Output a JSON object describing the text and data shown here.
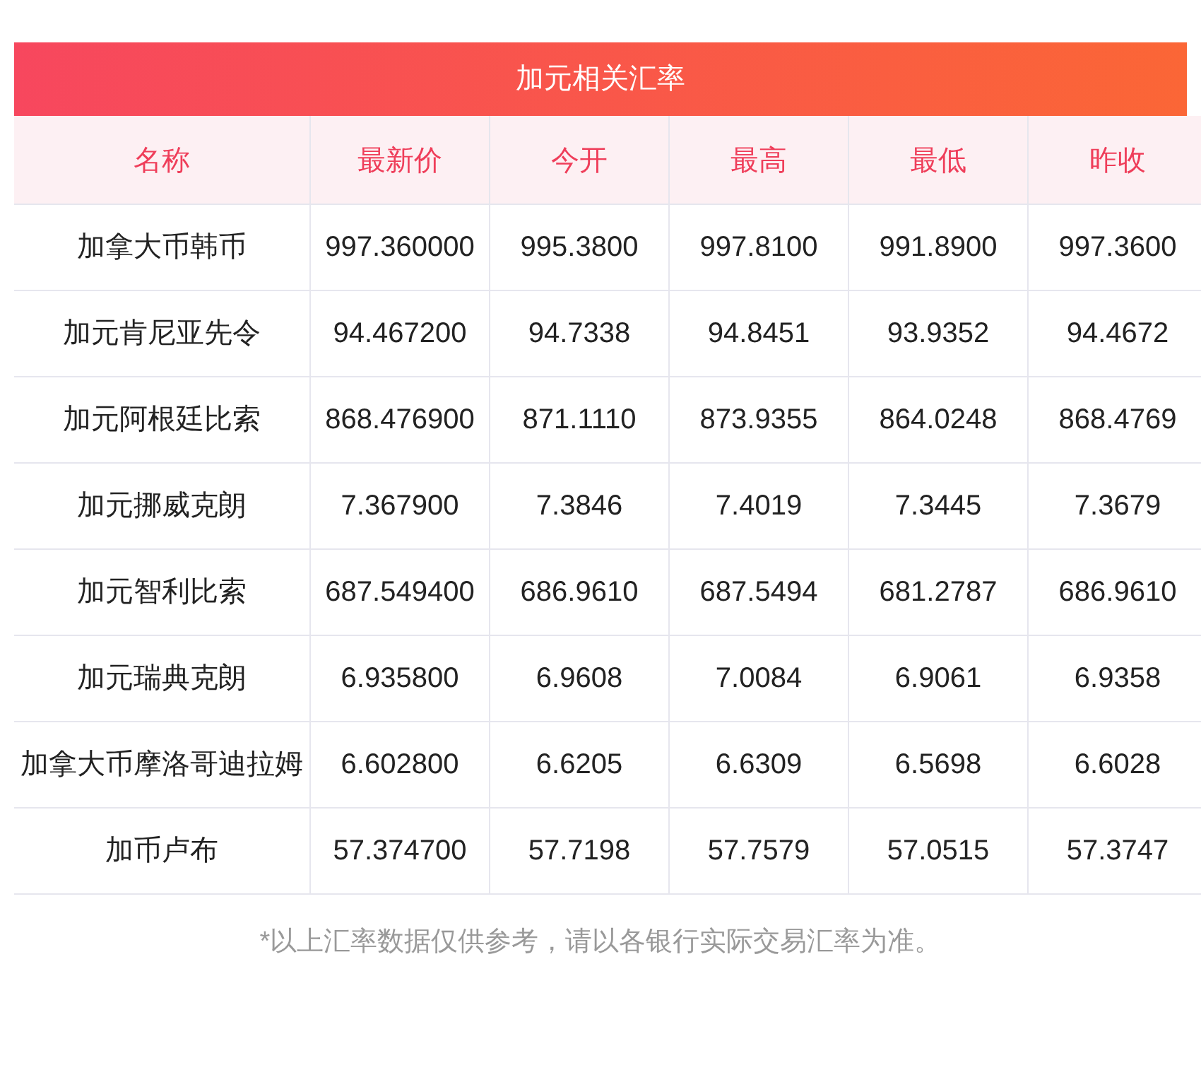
{
  "title": "加元相关汇率",
  "columns": [
    "名称",
    "最新价",
    "今开",
    "最高",
    "最低",
    "昨收"
  ],
  "rows": [
    [
      "加拿大币韩币",
      "997.360000",
      "995.3800",
      "997.8100",
      "991.8900",
      "997.3600"
    ],
    [
      "加元肯尼亚先令",
      "94.467200",
      "94.7338",
      "94.8451",
      "93.9352",
      "94.4672"
    ],
    [
      "加元阿根廷比索",
      "868.476900",
      "871.1110",
      "873.9355",
      "864.0248",
      "868.4769"
    ],
    [
      "加元挪威克朗",
      "7.367900",
      "7.3846",
      "7.4019",
      "7.3445",
      "7.3679"
    ],
    [
      "加元智利比索",
      "687.549400",
      "686.9610",
      "687.5494",
      "681.2787",
      "686.9610"
    ],
    [
      "加元瑞典克朗",
      "6.935800",
      "6.9608",
      "7.0084",
      "6.9061",
      "6.9358"
    ],
    [
      "加拿大币摩洛哥迪拉姆",
      "6.602800",
      "6.6205",
      "6.6309",
      "6.5698",
      "6.6028"
    ],
    [
      "加币卢布",
      "57.374700",
      "57.7198",
      "57.7579",
      "57.0515",
      "57.3747"
    ]
  ],
  "footnote": "*以上汇率数据仅供参考，请以各银行实际交易汇率为准。"
}
